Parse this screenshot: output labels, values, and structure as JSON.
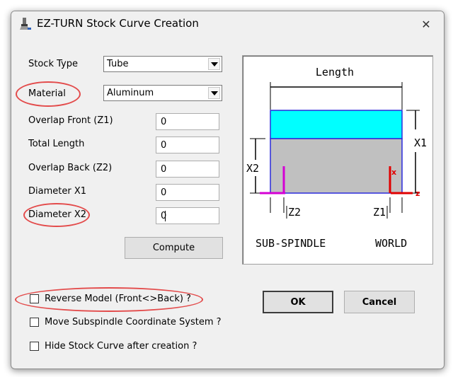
{
  "window": {
    "title": "EZ-TURN Stock Curve Creation",
    "close_glyph": "✕"
  },
  "form": {
    "stock_type": {
      "label": "Stock Type",
      "value": "Tube"
    },
    "material": {
      "label": "Material",
      "value": "Aluminum"
    },
    "overlap_front": {
      "label": "Overlap Front (Z1)",
      "value": "0"
    },
    "total_length": {
      "label": "Total Length",
      "value": "0"
    },
    "overlap_back": {
      "label": "Overlap Back (Z2)",
      "value": "0"
    },
    "diameter_x1": {
      "label": "Diameter X1",
      "value": "0"
    },
    "diameter_x2": {
      "label": "Diameter X2",
      "value": "0"
    },
    "compute_label": "Compute"
  },
  "options": [
    {
      "label": "Reverse Model (Front<>Back) ?",
      "checked": false
    },
    {
      "label": "Move Subspindle Coordinate System ?",
      "checked": false
    },
    {
      "label": "Hide Stock Curve after creation ?",
      "checked": false
    }
  ],
  "buttons": {
    "ok": "OK",
    "cancel": "Cancel"
  },
  "diagram": {
    "length": "Length",
    "x1": "X1",
    "x2": "X2",
    "z1": "Z1",
    "z2": "Z2",
    "axis_x": "x",
    "axis_z": "z",
    "sub_spindle": "SUB-SPINDLE",
    "world": "WORLD"
  },
  "colors": {
    "highlight_ellipse": "#e34b4b",
    "stock_top": "#00ffff",
    "stock_body": "#c0c0c0",
    "stock_border": "#2a2adc",
    "subspindle_axis": "#d400d4",
    "world_axis": "#e00000"
  }
}
